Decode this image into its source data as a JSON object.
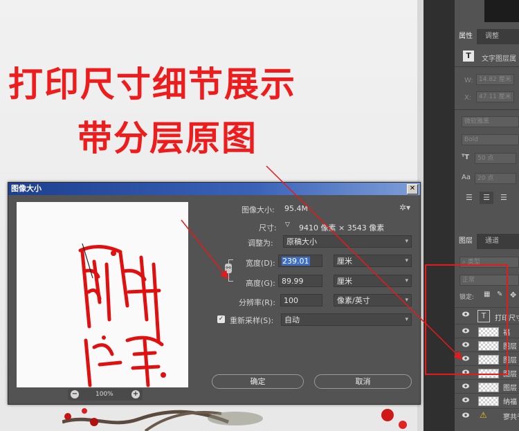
{
  "banner": {
    "line1": "打印尺寸细节展示",
    "line2": "带分层原图"
  },
  "dialog": {
    "title": "图像大小",
    "close_glyph": "✕",
    "image_size_label": "图像大小:",
    "image_size_value": "95.4M",
    "dimensions_label": "尺寸:",
    "dimensions_value": "9410 像素  ×  3543 像素",
    "fit_to_label": "调整为:",
    "fit_to_value": "原稿大小",
    "width_label": "宽度(D):",
    "width_value": "239.01",
    "width_unit": "厘米",
    "height_label": "高度(G):",
    "height_value": "89.99",
    "height_unit": "厘米",
    "resolution_label": "分辨率(R):",
    "resolution_value": "100",
    "resolution_unit": "像素/英寸",
    "resample_label": "重新采样(S):",
    "resample_value": "自动",
    "resample_checked": true,
    "zoom_value": "100%",
    "ok_label": "确定",
    "cancel_label": "取消"
  },
  "right_panel": {
    "properties_tabs": [
      "属性",
      "调整"
    ],
    "layer_kind": "文字图层属",
    "w_label": "W:",
    "w_value": "14.82 厘米",
    "x_label": "X:",
    "x_value": "47.11 厘米",
    "font_family": "微软雅黑",
    "font_style": "Bold",
    "font_size": "50 点",
    "leading": "20 点",
    "layers_tabs": [
      "图层",
      "通道"
    ],
    "filter_label": "类型",
    "blend_mode": "正常",
    "lock_label": "锁定:",
    "layers": [
      {
        "name": "打印尺寸",
        "kind": "text"
      },
      {
        "name": "福",
        "kind": "pixel"
      },
      {
        "name": "图层",
        "kind": "pixel"
      },
      {
        "name": "图层",
        "kind": "pixel"
      },
      {
        "name": "图层",
        "kind": "pixel"
      },
      {
        "name": "图层",
        "kind": "pixel"
      },
      {
        "name": "纳福",
        "kind": "pixel"
      },
      {
        "name": "寥共千里",
        "kind": "warning"
      }
    ]
  },
  "colors": {
    "annotation_red": "#ee1c1c",
    "dialog_bg": "#535353",
    "panel_bg": "#535353",
    "selection_blue": "#3d6ec4"
  }
}
